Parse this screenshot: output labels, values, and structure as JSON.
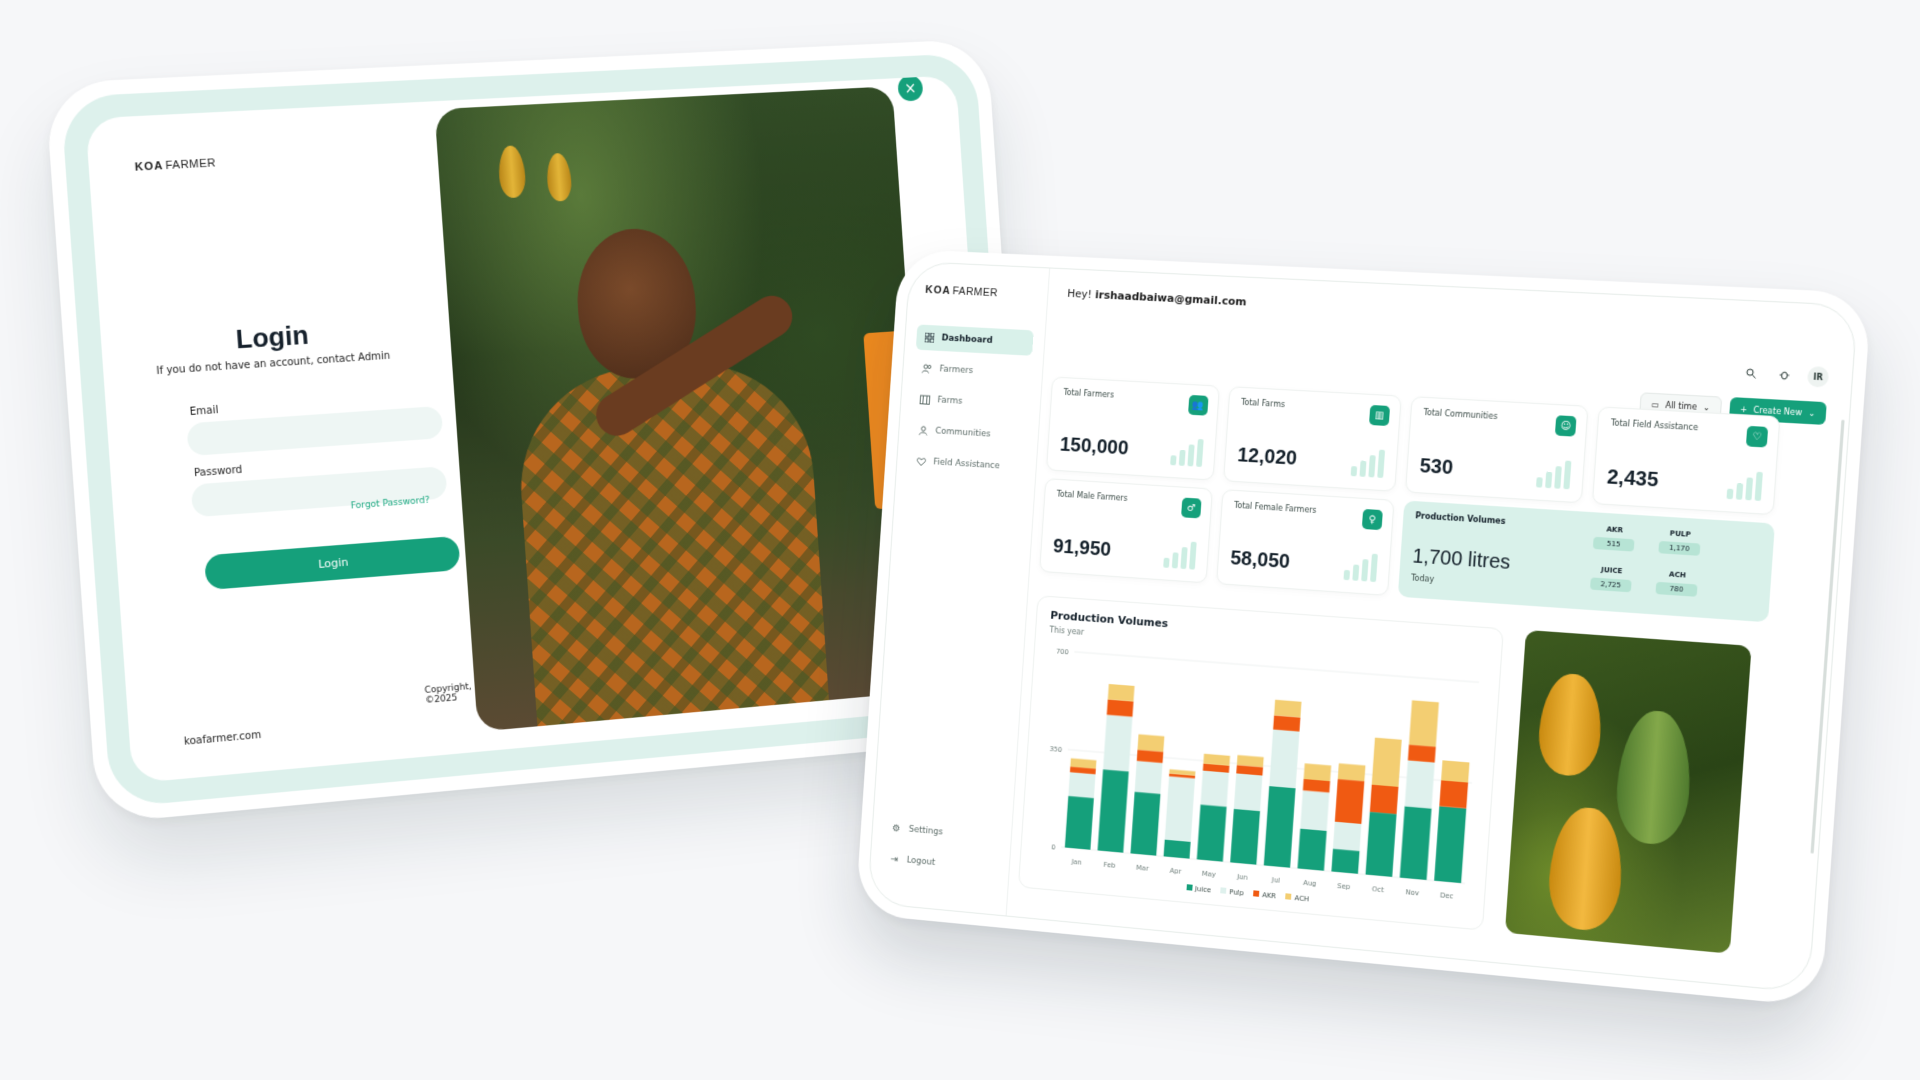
{
  "login": {
    "brand_bold": "KOA",
    "brand_rest": "FARMER",
    "title": "Login",
    "subtitle": "If you do not have an account, contact Admin",
    "email_label": "Email",
    "email_value": "",
    "password_label": "Password",
    "password_value": "",
    "forgot": "Forgot Password?",
    "login_button": "Login",
    "footer_url": "koafarmer.com",
    "copyright": "Copyright, ©2025",
    "close_icon": "×"
  },
  "dashboard": {
    "brand_bold": "KOA",
    "brand_rest": "FARMER",
    "greeting_prefix": "Hey!",
    "greeting_email": "irshaadbaiwa@gmail.com",
    "avatar": "IR",
    "filter_label": "All time",
    "create_label": "Create New",
    "nav": [
      {
        "label": "Dashboard",
        "icon": "grid-icon"
      },
      {
        "label": "Farmers",
        "icon": "users-icon"
      },
      {
        "label": "Farms",
        "icon": "barn-icon"
      },
      {
        "label": "Communities",
        "icon": "community-icon"
      },
      {
        "label": "Field Assistance",
        "icon": "heart-hand-icon"
      }
    ],
    "nav_bottom": [
      {
        "label": "Settings",
        "icon": "gear-icon"
      },
      {
        "label": "Logout",
        "icon": "logout-icon"
      }
    ],
    "stats": [
      {
        "label": "Total Farmers",
        "value": "150,000",
        "icon": "users-icon"
      },
      {
        "label": "Total Farms",
        "value": "12,020",
        "icon": "barn-icon"
      },
      {
        "label": "Total Communities",
        "value": "530",
        "icon": "community-icon"
      },
      {
        "label": "Total Field Assistance",
        "value": "2,435",
        "icon": "heart-hand-icon"
      },
      {
        "label": "Total Male Farmers",
        "value": "91,950",
        "icon": "male-icon"
      },
      {
        "label": "Total Female Farmers",
        "value": "58,050",
        "icon": "female-icon"
      }
    ],
    "production": {
      "title": "Production Volumes",
      "value": "1,700 litres",
      "period": "Today",
      "items": [
        {
          "key": "AKR",
          "value": "515"
        },
        {
          "key": "PULP",
          "value": "1,170"
        },
        {
          "key": "JUICE",
          "value": "2,725"
        },
        {
          "key": "ACH",
          "value": "780"
        }
      ]
    }
  },
  "chart_data": {
    "type": "bar",
    "stacked": true,
    "title": "Production Volumes",
    "subtitle": "This year",
    "categories": [
      "Jan",
      "Feb",
      "Mar",
      "Apr",
      "May",
      "Jun",
      "Jul",
      "Aug",
      "Sep",
      "Oct",
      "Nov",
      "Dec"
    ],
    "yticks": [
      0,
      350,
      700
    ],
    "ylim": [
      0,
      700
    ],
    "series": [
      {
        "name": "Juice",
        "color": "#15a07b",
        "values": [
          185,
          290,
          220,
          60,
          195,
          190,
          280,
          140,
          80,
          220,
          250,
          260
        ]
      },
      {
        "name": "Pulp",
        "color": "#dff1ed",
        "values": [
          85,
          195,
          110,
          225,
          120,
          125,
          200,
          135,
          95,
          0,
          160,
          0
        ]
      },
      {
        "name": "AKR",
        "color": "#f05a12",
        "values": [
          20,
          55,
          40,
          10,
          25,
          30,
          50,
          40,
          150,
          95,
          55,
          90
        ]
      },
      {
        "name": "ACH",
        "color": "#f3ce72",
        "values": [
          30,
          55,
          55,
          15,
          35,
          35,
          55,
          55,
          55,
          165,
          155,
          70
        ]
      }
    ],
    "legend": "bottom"
  }
}
